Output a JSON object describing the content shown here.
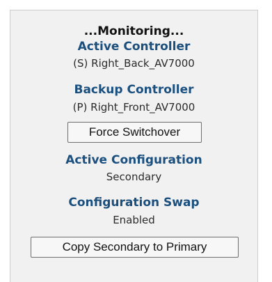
{
  "panel": {
    "status_text": "...Monitoring...",
    "active_controller": {
      "heading": "Active Controller",
      "value": "(S) Right_Back_AV7000"
    },
    "backup_controller": {
      "heading": "Backup Controller",
      "value": "(P) Right_Front_AV7000"
    },
    "force_switchover_label": "Force Switchover",
    "active_configuration": {
      "heading": "Active Configuration",
      "value": "Secondary"
    },
    "configuration_swap": {
      "heading": "Configuration Swap",
      "value": "Enabled"
    },
    "copy_button_label": "Copy Secondary to Primary"
  },
  "colors": {
    "heading": "#1a4f7e",
    "panel_background": "#f1f1f1"
  }
}
